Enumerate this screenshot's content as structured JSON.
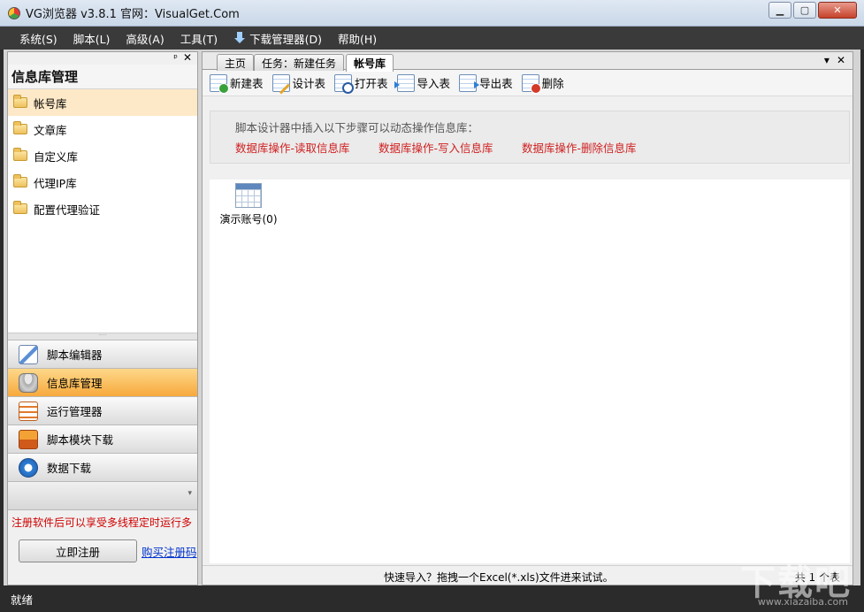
{
  "window": {
    "title": "VG浏览器 v3.8.1 官网：VisualGet.Com",
    "minimize": "▁",
    "maximize": "▢",
    "close": "✕"
  },
  "menu": {
    "items": [
      "系统(S)",
      "脚本(L)",
      "高级(A)",
      "工具(T)",
      "下载管理器(D)",
      "帮助(H)"
    ]
  },
  "left_panel": {
    "pin": "ᵖ",
    "close": "✕",
    "heading": "信息库管理",
    "tree": [
      "帐号库",
      "文章库",
      "自定义库",
      "代理IP库",
      "配置代理验证"
    ],
    "selected_index": 0,
    "nav": [
      "脚本编辑器",
      "信息库管理",
      "运行管理器",
      "脚本模块下载",
      "数据下载"
    ],
    "active_nav_index": 1,
    "promo": "注册软件后可以享受多线程定时运行多",
    "register_button": "立即注册",
    "buy_link": "购买注册码"
  },
  "tabs": {
    "items": [
      "主页",
      "任务：新建任务",
      "帐号库"
    ],
    "active_index": 2,
    "dropdown": "▾",
    "close": "✕"
  },
  "toolbar": {
    "new_table": "新建表",
    "design_table": "设计表",
    "open_table": "打开表",
    "import_table": "导入表",
    "export_table": "导出表",
    "delete": "删除"
  },
  "info": {
    "description": "脚本设计器中插入以下步骤可以动态操作信息库：",
    "link_read": "数据库操作-读取信息库",
    "link_write": "数据库操作-写入信息库",
    "link_delete": "数据库操作-删除信息库"
  },
  "tables": [
    {
      "label": "演示账号(0)"
    }
  ],
  "main_status": {
    "hint": "快速导入？拖拽一个Excel(*.xls)文件进来试试。",
    "count": "共 1 个表"
  },
  "status_bar": {
    "text": "就绪"
  },
  "watermark": {
    "main": "下载吧",
    "sub": "www.xiazaiba.com"
  },
  "colors": {
    "menubar_bg": "#3a3a3a",
    "selected_tree": "#fde9c7",
    "active_nav": "#f7a93c",
    "link_red": "#d02020",
    "promo_red": "#d00000"
  }
}
